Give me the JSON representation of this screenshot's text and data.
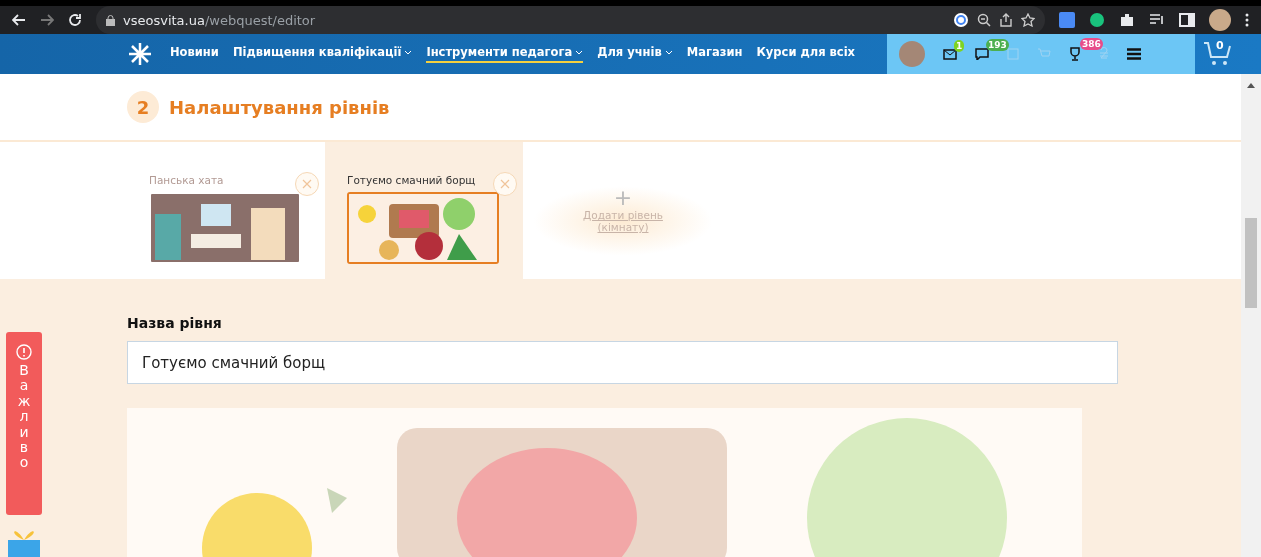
{
  "browser": {
    "url_host": "vseosvita.ua",
    "url_path": "/webquest/editor"
  },
  "nav": {
    "items": [
      {
        "label": "Новини",
        "dropdown": false,
        "selected": false
      },
      {
        "label": "Підвищення кваліфікації",
        "dropdown": true,
        "selected": false
      },
      {
        "label": "Інструменти педагога",
        "dropdown": true,
        "selected": true
      },
      {
        "label": "Для учнів",
        "dropdown": true,
        "selected": false
      },
      {
        "label": "Магазин",
        "dropdown": false,
        "selected": false
      },
      {
        "label": "Курси для всіх",
        "dropdown": false,
        "selected": false
      }
    ],
    "badges": {
      "mail": "1",
      "messages": "193",
      "trophy": "386"
    },
    "cart_count": "0"
  },
  "section": {
    "number": "2",
    "title": "Налаштування рівнів"
  },
  "levels": [
    {
      "title": "Панська хата",
      "selected": false,
      "kind": "room"
    },
    {
      "title": "Готуємо смачний борщ",
      "selected": true,
      "kind": "food"
    }
  ],
  "add_level": {
    "icon": "+",
    "label": "Додати рівень (кімнату)"
  },
  "level_name": {
    "label": "Назва рівня",
    "value": "Готуємо смачний борщ"
  },
  "important_tab": {
    "label": "Важливо"
  }
}
